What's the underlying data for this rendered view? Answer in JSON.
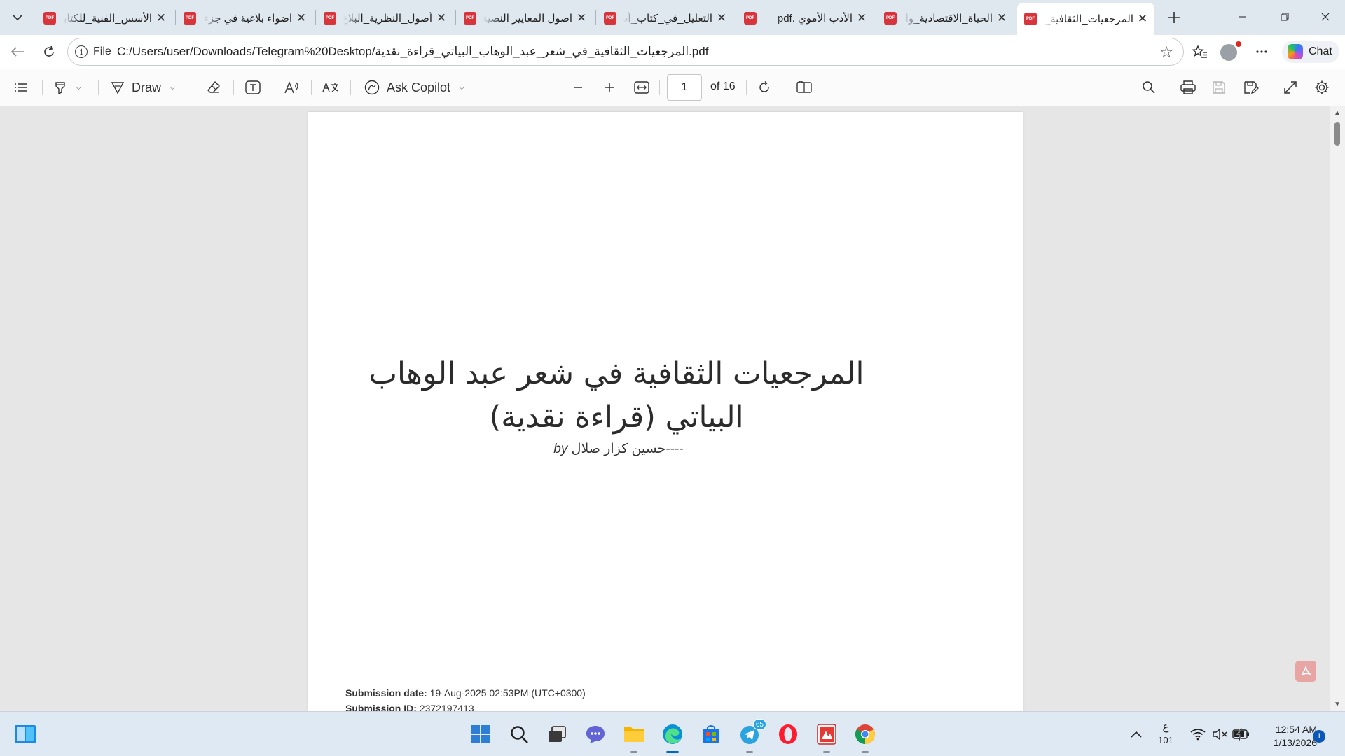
{
  "tabs": [
    {
      "title": "الأسس_الفنية_للكتابة",
      "closable": true
    },
    {
      "title": "اضواء بلاغية في جزء",
      "closable": true
    },
    {
      "title": "أصول_النظرية_البلاغ",
      "closable": true
    },
    {
      "title": "اصول المعايير النصية",
      "closable": true
    },
    {
      "title": "التعليل_في_كتاب_أسا",
      "closable": true
    },
    {
      "title": "الأدب الأموي .pdf",
      "closable": true
    },
    {
      "title": "الحياة_الاقتصادية_وأث",
      "closable": true
    },
    {
      "title": "المرجعيات_الثقافية_في",
      "closable": true,
      "active": true
    }
  ],
  "tab_icon_label": "PDF",
  "close_glyph": "✕",
  "address": {
    "scheme": "File",
    "url": "C:/Users/user/Downloads/Telegram%20Desktop/المرجعيات_الثقافية_في_شعر_عبد_الوهاب_البياتي_قراءة_نقدية.pdf"
  },
  "chat_label": "Chat",
  "pdf_toolbar": {
    "draw_label": "Draw",
    "ask_copilot_label": "Ask Copilot",
    "current_page": "1",
    "page_count_label": "of 16"
  },
  "document": {
    "title_line1": "المرجعيات الثقافية في شعر عبد الوهاب",
    "title_line2": "البياتي (قراءة نقدية)",
    "author": "حسين كزار صلال----",
    "by": "by",
    "submission_date_label": "Submission date:",
    "submission_date_value": "19-Aug-2025 02:53PM (UTC+0300)",
    "submission_id_label": "Submission ID:",
    "submission_id_value": "2372197413"
  },
  "taskbar": {
    "telegram_badge": "65",
    "lang_indicator": "ع",
    "lang_sub": "101",
    "time": "12:54 AM",
    "date": "1/13/2026",
    "notification_count": "1"
  },
  "colors": {
    "accent": "#0067c0",
    "pdf_red": "#d8343b",
    "tabstrip_bg": "#dfe7ef",
    "viewer_bg": "#e6e6e6"
  }
}
